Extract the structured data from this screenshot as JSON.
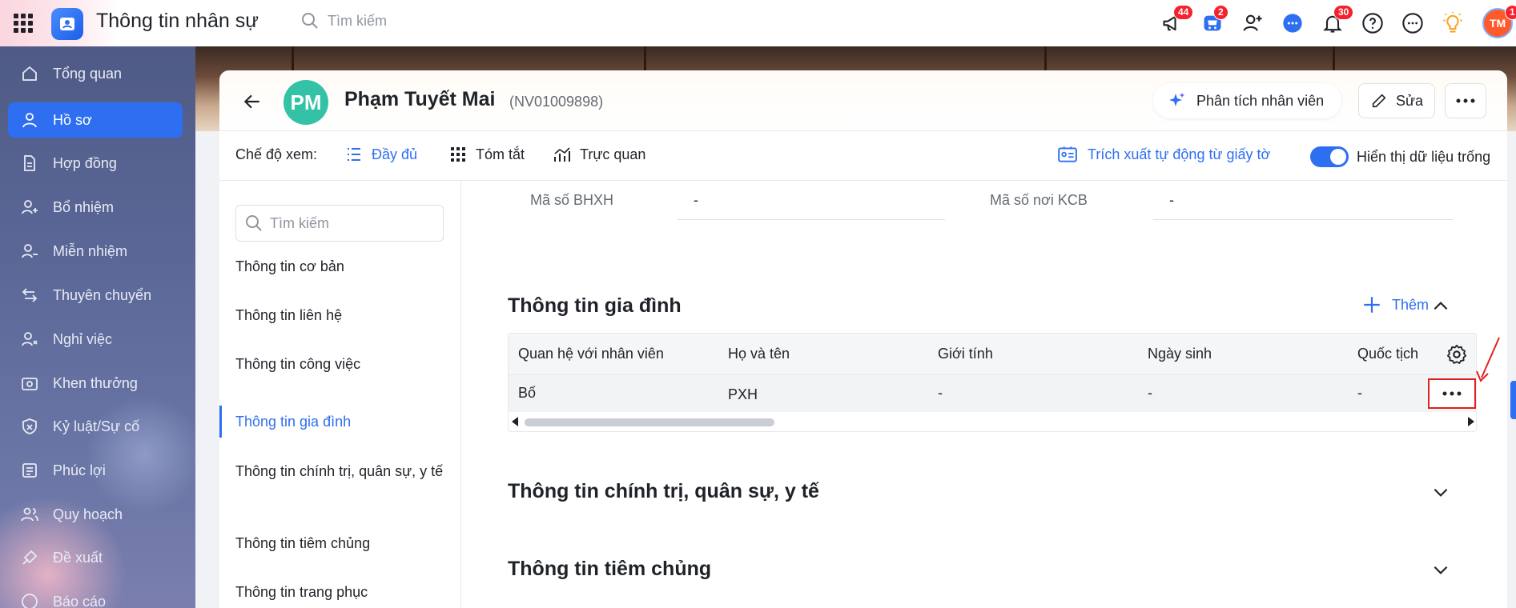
{
  "app": {
    "title": "Thông tin nhân sự",
    "search_placeholder": "Tìm kiếm",
    "badges": {
      "announcements": "44",
      "cart": "2",
      "notifications": "30",
      "avatar": "1"
    },
    "user_initials": "TM"
  },
  "sidebar": {
    "items": [
      {
        "label": "Tổng quan",
        "icon": "home-icon"
      },
      {
        "label": "Hồ sơ",
        "icon": "user-icon",
        "active": true
      },
      {
        "label": "Hợp đồng",
        "icon": "document-icon"
      },
      {
        "label": "Bổ nhiệm",
        "icon": "user-plus-icon"
      },
      {
        "label": "Miễn nhiệm",
        "icon": "user-minus-icon"
      },
      {
        "label": "Thuyên chuyển",
        "icon": "transfer-icon"
      },
      {
        "label": "Nghỉ việc",
        "icon": "user-leave-icon"
      },
      {
        "label": "Khen thưởng",
        "icon": "reward-icon"
      },
      {
        "label": "Kỷ luật/Sự cố",
        "icon": "shield-icon"
      },
      {
        "label": "Phúc lợi",
        "icon": "benefit-icon"
      },
      {
        "label": "Quy hoạch",
        "icon": "users-icon"
      },
      {
        "label": "Đề xuất",
        "icon": "proposal-icon"
      },
      {
        "label": "Báo cáo",
        "icon": "report-icon"
      }
    ]
  },
  "employee": {
    "initials": "PM",
    "name": "Phạm Tuyết Mai",
    "code": "(NV01009898)",
    "analyze_label": "Phân tích nhân viên",
    "edit_label": "Sửa"
  },
  "viewbar": {
    "label": "Chế độ xem:",
    "options": [
      "Đầy đủ",
      "Tóm tắt",
      "Trực quan"
    ],
    "active": "Đầy đủ",
    "extract_label": "Trích xuất tự động từ giấy tờ",
    "toggle_label": "Hiển thị dữ liệu trống"
  },
  "section_nav": {
    "search_placeholder": "Tìm kiếm",
    "items": [
      "Thông tin cơ bản",
      "Thông tin liên hệ",
      "Thông tin công việc",
      "Thông tin gia đình",
      "Thông tin chính trị, quân sự, y tế",
      "Thông tin tiêm chủng",
      "Thông tin trang phục"
    ],
    "active": "Thông tin gia đình"
  },
  "fields": {
    "bhxh_label": "Mã số BHXH",
    "bhxh_value": "-",
    "kcb_label": "Mã số nơi KCB",
    "kcb_value": "-"
  },
  "family": {
    "title": "Thông tin gia đình",
    "add_label": "Thêm",
    "columns": [
      "Quan hệ với nhân viên",
      "Họ và tên",
      "Giới tính",
      "Ngày sinh",
      "Quốc tịch"
    ],
    "rows": [
      {
        "relation": "Bố",
        "name": "PXH",
        "gender": "-",
        "dob": "-",
        "nationality": "-"
      }
    ]
  },
  "sections": {
    "political": "Thông tin chính trị, quân sự, y tế",
    "vaccine": "Thông tin tiêm chủng"
  },
  "colors": {
    "accent": "#2e6ff2",
    "highlight": "#e0201f",
    "avatar": "#33c2a5"
  }
}
